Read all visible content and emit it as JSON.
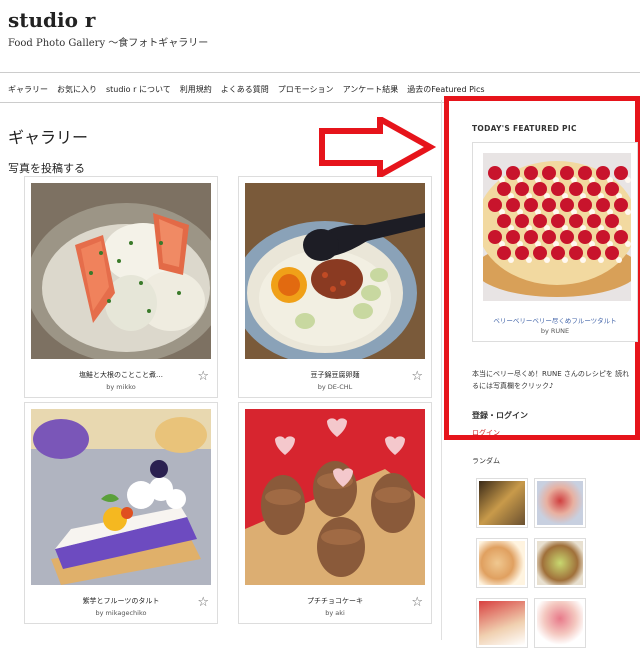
{
  "header": {
    "title": "studio r",
    "subtitle": "Food Photo Gallery ～食フォトギャラリー"
  },
  "nav": {
    "items": [
      "ギャラリー",
      "お気に入り",
      "studio r について",
      "利用規約",
      "よくある質問",
      "プロモーション",
      "アンケート結果",
      "過去のFeatured Pics"
    ]
  },
  "main": {
    "page_title": "ギャラリー",
    "post_link": "写真を投稿する",
    "gallery": [
      {
        "caption": "塩鮭と大根のことこと煮…",
        "by": "by mikko"
      },
      {
        "caption": "豆子錦豆腐卵麺",
        "by": "by DE-CHL"
      },
      {
        "caption": "紫芋とフルーツのタルト",
        "by": "by mikagechiko"
      },
      {
        "caption": "プチチョコケーキ",
        "by": "by aki"
      }
    ],
    "star_icon": "☆"
  },
  "sidebar": {
    "featured_title": "TODAY'S FEATURED PIC",
    "featured_caption": "ベリーベリーベリー尽くめフルーツタルト",
    "featured_by": "by RUNE",
    "featured_desc": "本当にベリー尽くめ！RUNE さんのレシピを 読れるには写真欄をクリック♪",
    "login_title": "登録・ログイン",
    "login_link": "ログイン",
    "random_title": "ランダム"
  },
  "colors": {
    "highlight_red": "#e6141b"
  }
}
